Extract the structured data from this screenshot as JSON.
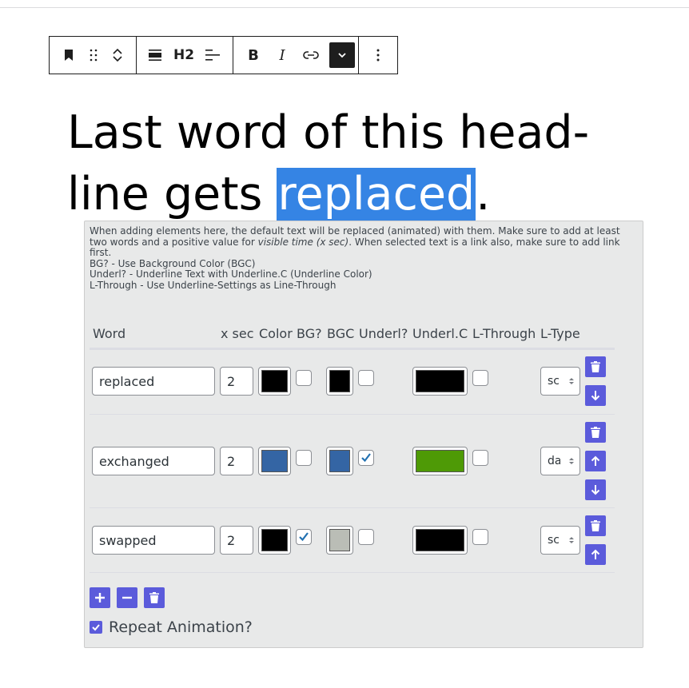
{
  "toolbar": {
    "block_type_icon": "bookmark-icon",
    "drag_icon": "drag-handle-icon",
    "move_icon": "move-up-down-icon",
    "align_icon": "align-full-icon",
    "heading_level": "H2",
    "text_align_icon": "text-align-left-icon",
    "bold_label": "B",
    "italic_label": "I",
    "link_icon": "link-icon",
    "more_rich_text_icon": "chevron-down-icon",
    "options_icon": "more-vertical-icon"
  },
  "heading": {
    "before": "Last word of this head-line gets ",
    "selected": "replaced",
    "after": "."
  },
  "panel": {
    "help": {
      "line1_a": "When adding elements here, the default text will be replaced (animated) with them. Make sure to add at least two words and a positive value for ",
      "line1_em": "visible time (x sec)",
      "line1_b": ". When selected text is a link also, make sure to add link first.",
      "line2": "BG? - Use Background Color (BGC)",
      "line3": "Underl? - Underline Text with Underline.C (Underline Color)",
      "line4": "L-Through - Use Underline-Settings as Line-Through"
    },
    "columns": [
      "Word",
      "x sec",
      "Color",
      "BG?",
      "BGC",
      "Underl?",
      "Underl.C",
      "L-Through",
      "L-Type"
    ],
    "rows": [
      {
        "word": "replaced",
        "xsec": "2",
        "color": "#000000",
        "bg": false,
        "bgc": "#000000",
        "underline": false,
        "underline_color": "#000000",
        "line_through": false,
        "ltype": "solid",
        "ltype_visible": "sc",
        "actions": [
          "delete",
          "move-down"
        ]
      },
      {
        "word": "exchanged",
        "xsec": "2",
        "color": "#3465a4",
        "bg": false,
        "bgc": "#3465a4",
        "underline": true,
        "underline_color": "#4e9a06",
        "line_through": false,
        "ltype": "dashed",
        "ltype_visible": "da",
        "actions": [
          "delete",
          "move-up",
          "move-down"
        ]
      },
      {
        "word": "swapped",
        "xsec": "2",
        "color": "#000000",
        "bg": true,
        "bgc": "#babdb6",
        "underline": false,
        "underline_color": "#000000",
        "line_through": false,
        "ltype": "solid",
        "ltype_visible": "sc",
        "actions": [
          "delete",
          "move-up"
        ]
      }
    ],
    "bottom_buttons": [
      "add",
      "remove",
      "delete-all"
    ],
    "repeat_label": "Repeat Animation?",
    "repeat_checked": true
  },
  "colors": {
    "accent": "#5b5bdb",
    "selection": "#3584e4",
    "panel_bg": "#e8e9e9",
    "check": "#2271b1"
  }
}
